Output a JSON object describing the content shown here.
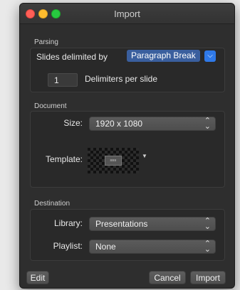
{
  "window": {
    "title": "Import"
  },
  "parsing": {
    "section_label": "Parsing",
    "delimited_label": "Slides delimited by",
    "delimiter_value": "Paragraph Break",
    "delimiters_count": "1",
    "delimiters_label": "Delimiters per slide"
  },
  "document": {
    "section_label": "Document",
    "size_label": "Size:",
    "size_value": "1920 x 1080",
    "template_label": "Template:"
  },
  "destination": {
    "section_label": "Destination",
    "library_label": "Library:",
    "library_value": "Presentations",
    "playlist_label": "Playlist:",
    "playlist_value": "None"
  },
  "buttons": {
    "edit": "Edit",
    "cancel": "Cancel",
    "import": "Import"
  },
  "colors": {
    "window_bg": "#2e2e2e",
    "accent": "#2f79e8",
    "selection": "#3a5f9e"
  }
}
